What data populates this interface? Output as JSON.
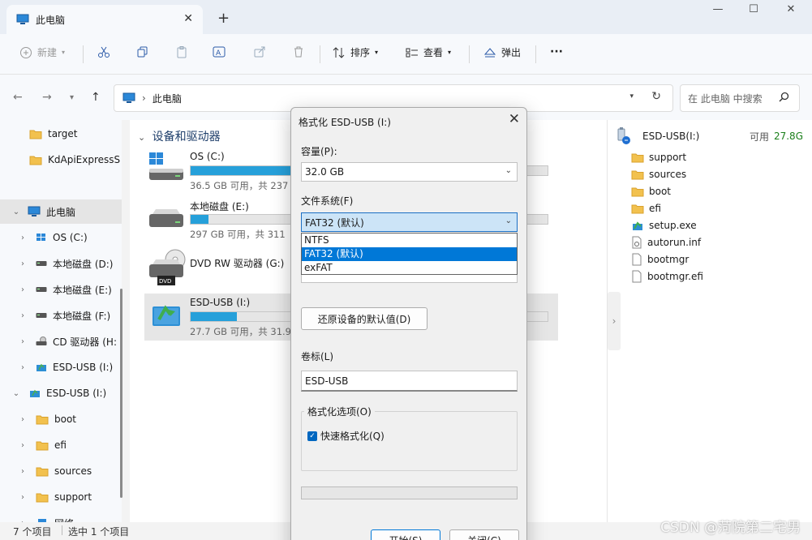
{
  "window": {
    "tab_title": "此电脑",
    "new_tab": "+",
    "minimize": "—",
    "maximize": "☐",
    "close": "✕"
  },
  "toolbar": {
    "new_label": "新建",
    "sort_label": "排序",
    "view_label": "查看",
    "eject_label": "弹出",
    "more_label": "···"
  },
  "address": {
    "path_root": "此电脑",
    "search_placeholder": "在 此电脑 中搜索"
  },
  "nav": {
    "items": [
      {
        "label": "target"
      },
      {
        "label": "KdApiExpressS"
      },
      {
        "label": "此电脑"
      },
      {
        "label": "OS (C:)"
      },
      {
        "label": "本地磁盘 (D:)"
      },
      {
        "label": "本地磁盘 (E:)"
      },
      {
        "label": "本地磁盘 (F:)"
      },
      {
        "label": "CD 驱动器 (H:"
      },
      {
        "label": "ESD-USB (I:)"
      },
      {
        "label": "ESD-USB (I:)"
      },
      {
        "label": "boot"
      },
      {
        "label": "efi"
      },
      {
        "label": "sources"
      },
      {
        "label": "support"
      },
      {
        "label": "网络"
      }
    ]
  },
  "main": {
    "group_title": "设备和驱动器",
    "drives": [
      {
        "name": "OS (C:)",
        "info": "36.5 GB 可用，共 237",
        "used_fraction": 0.85
      },
      {
        "name": "本地磁盘 (E:)",
        "info": "297 GB 可用，共 311",
        "used_fraction": 0.05
      },
      {
        "name": "DVD RW 驱动器 (G:)",
        "info": "",
        "used_fraction": 0
      },
      {
        "name": "ESD-USB (I:)",
        "info": "27.7 GB 可用，共 31.9",
        "used_fraction": 0.13
      }
    ]
  },
  "right_pane": {
    "drive_name": "ESD-USB(I:)",
    "free_label": "可用",
    "free_value": "27.8G",
    "items": [
      {
        "label": "support",
        "kind": "folder"
      },
      {
        "label": "sources",
        "kind": "folder"
      },
      {
        "label": "boot",
        "kind": "folder"
      },
      {
        "label": "efi",
        "kind": "folder"
      },
      {
        "label": "setup.exe",
        "kind": "setup"
      },
      {
        "label": "autorun.inf",
        "kind": "config"
      },
      {
        "label": "bootmgr",
        "kind": "file"
      },
      {
        "label": "bootmgr.efi",
        "kind": "file"
      }
    ]
  },
  "status": {
    "count": "7 个项目",
    "selected": "选中 1 个项目"
  },
  "dialog": {
    "title": "格式化 ESD-USB (I:)",
    "capacity_label": "容量(P):",
    "capacity_value": "32.0 GB",
    "fs_label": "文件系统(F)",
    "fs_value": "FAT32 (默认)",
    "fs_options": [
      "NTFS",
      "FAT32 (默认)",
      "exFAT"
    ],
    "fs_highlighted": "FAT32 (默认)",
    "restore_button": "还原设备的默认值(D)",
    "volume_label": "卷标(L)",
    "volume_value": "ESD-USB",
    "options_group": "格式化选项(O)",
    "quick_format": "快速格式化(Q)",
    "quick_format_checked": true,
    "start_button": "开始(S)",
    "close_button": "关闭(C)",
    "progress_fraction": 0
  },
  "watermark": "CSDN @菏院第二宅男",
  "colors": {
    "accent": "#0078d7",
    "bar_fill": "#26a0da",
    "folder": "#f2c14e"
  }
}
